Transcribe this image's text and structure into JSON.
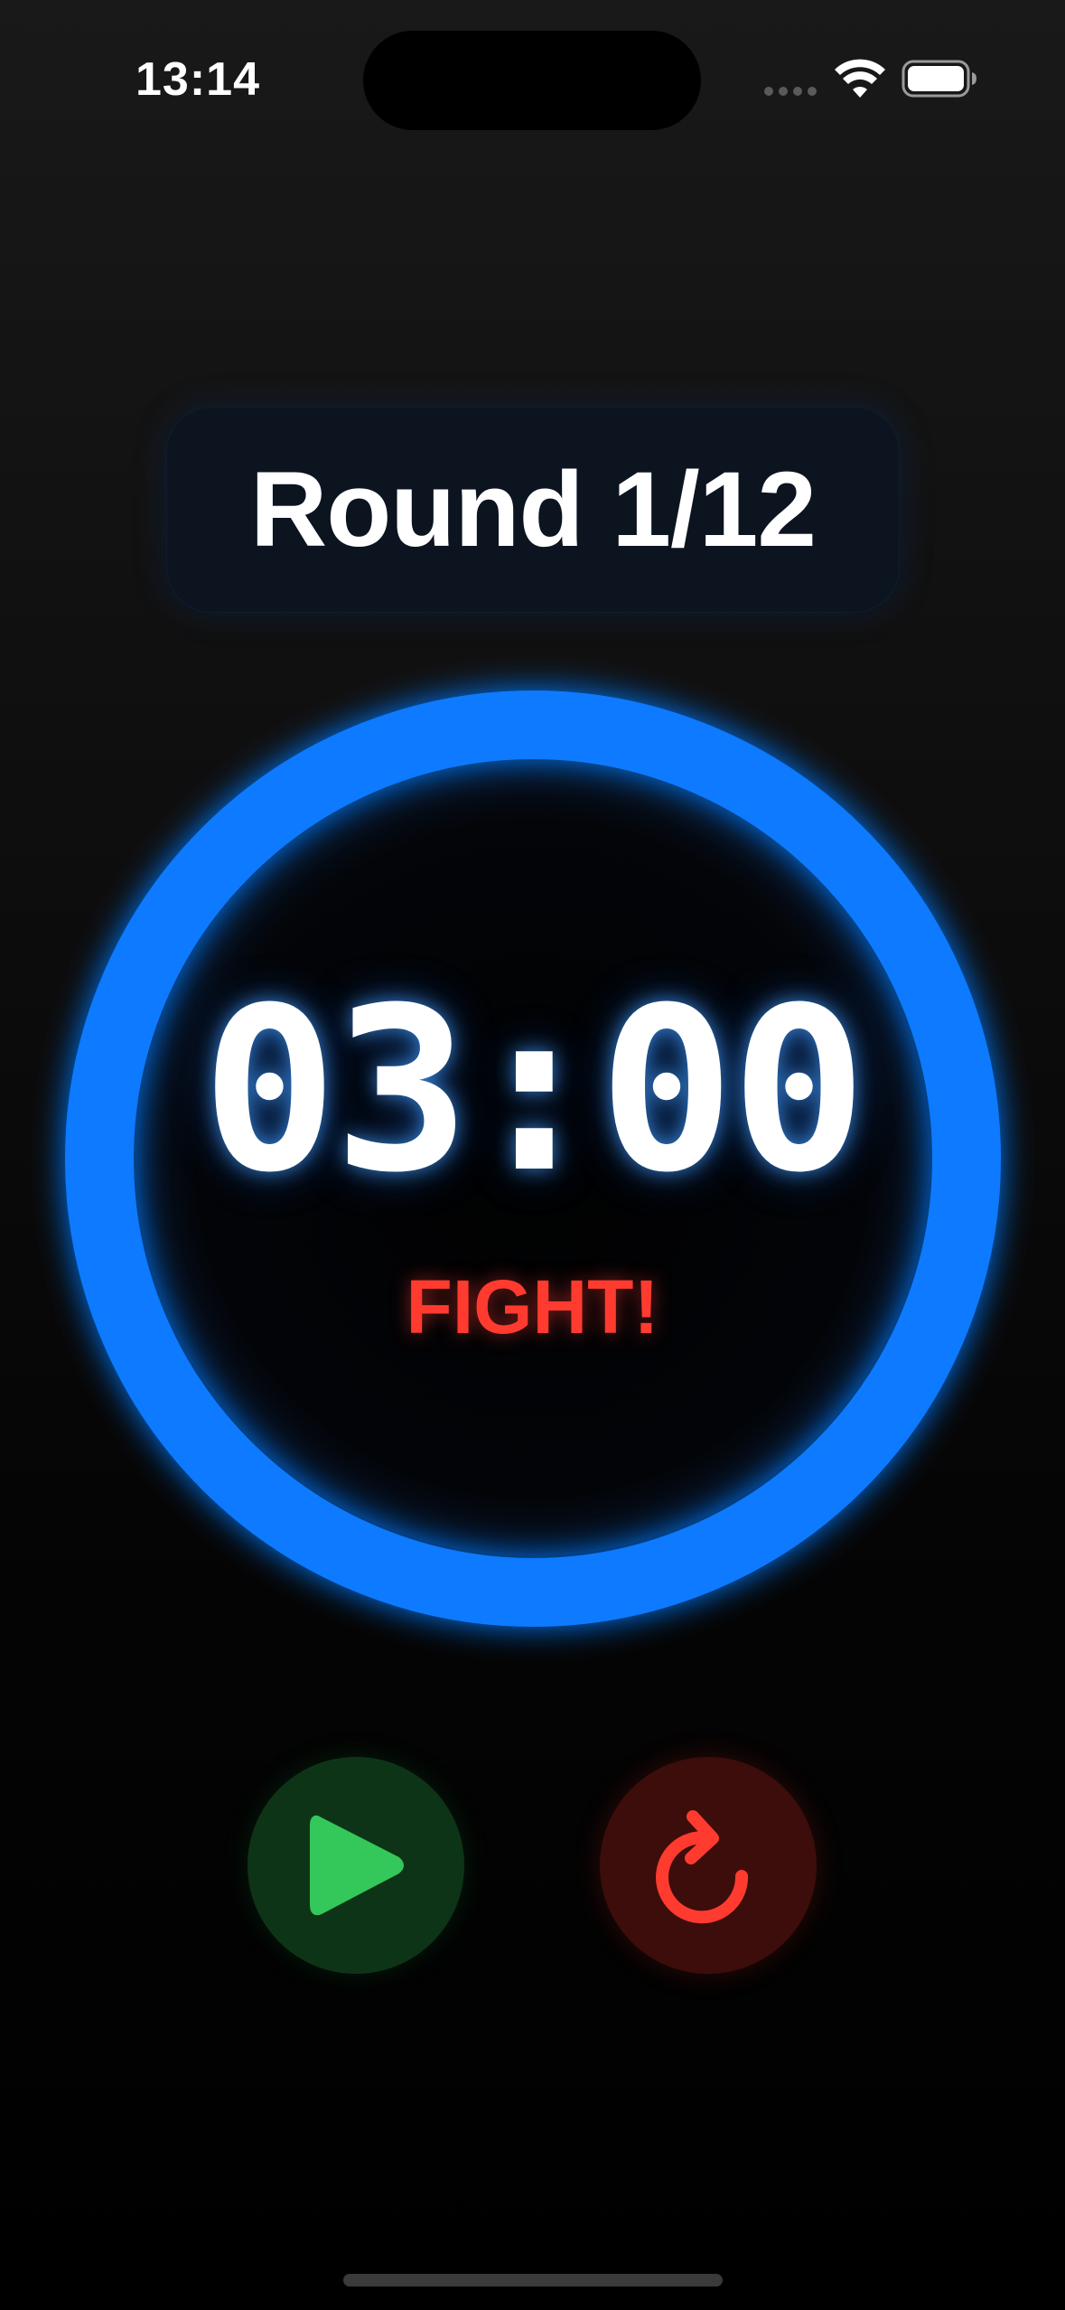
{
  "status_bar": {
    "time": "13:14",
    "icons": [
      "signal-dots-icon",
      "wifi-icon",
      "battery-icon"
    ]
  },
  "round": {
    "label": "Round 1/12",
    "current": 1,
    "total": 12
  },
  "timer": {
    "display": "03:00",
    "phase": "FIGHT!",
    "progress": 1.0
  },
  "controls": {
    "play_icon": "play-icon",
    "reset_icon": "reset-icon"
  },
  "colors": {
    "ring": "#0A7AFF",
    "phase": "#FF3B30",
    "play": "#34C759",
    "play_bg": "#0E3417",
    "reset": "#FF3B30",
    "reset_bg": "#3C0D0B",
    "badge_bg": "#0C1420"
  }
}
